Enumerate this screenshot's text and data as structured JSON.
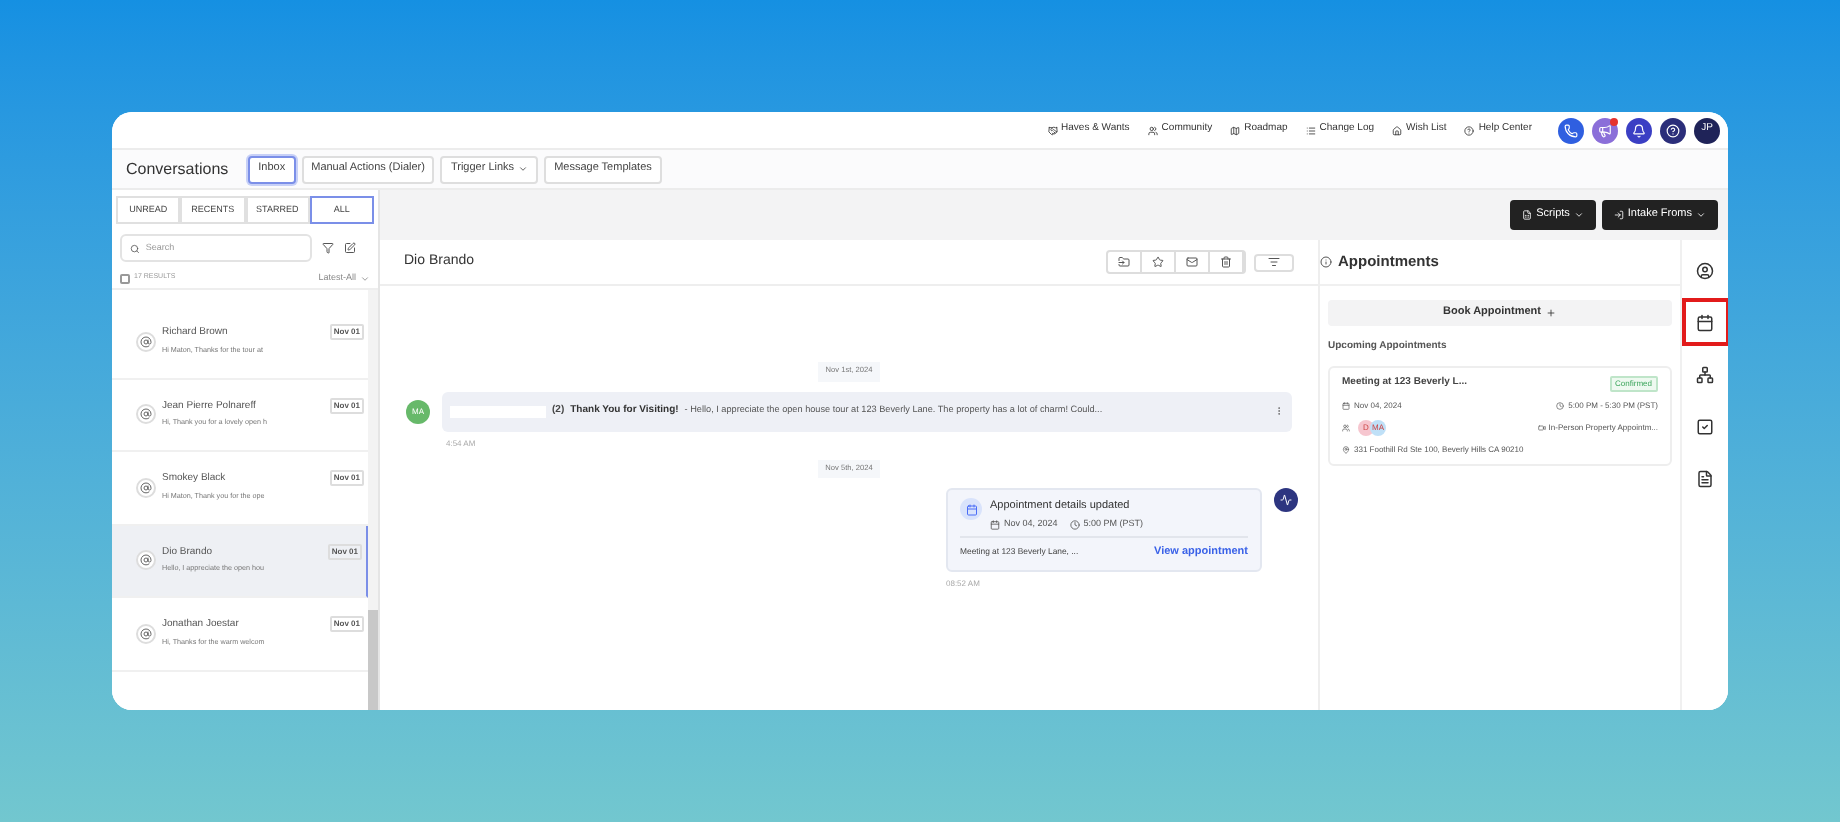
{
  "top_links": [
    {
      "kind": "haves",
      "label": "Haves & Wants"
    },
    {
      "kind": "community",
      "label": "Community"
    },
    {
      "kind": "roadmap",
      "label": "Roadmap"
    },
    {
      "kind": "changelog",
      "label": "Change Log"
    },
    {
      "kind": "wishlist",
      "label": "Wish List"
    },
    {
      "kind": "help",
      "label": "Help Center"
    }
  ],
  "top_actions": [
    {
      "kind": "phone",
      "color": "#2f5fe0",
      "badge": false
    },
    {
      "kind": "megaphone",
      "color": "#8b6fd9",
      "badge": true
    },
    {
      "kind": "bell",
      "color": "#3b3fc4",
      "badge": false
    },
    {
      "kind": "question",
      "color": "#2b2e7a",
      "badge": false
    }
  ],
  "user_avatar": {
    "initials": "JP"
  },
  "header": {
    "title": "Conversations",
    "tabs": [
      {
        "label": "Inbox",
        "selected": true,
        "dropdown": false
      },
      {
        "label": "Manual Actions (Dialer)",
        "selected": false,
        "dropdown": false
      },
      {
        "label": "Trigger Links",
        "selected": false,
        "dropdown": true
      },
      {
        "label": "Message Templates",
        "selected": false,
        "dropdown": false
      }
    ]
  },
  "filter_tabs": [
    {
      "label": "UNREAD",
      "selected": false
    },
    {
      "label": "RECENTS",
      "selected": false
    },
    {
      "label": "STARRED",
      "selected": false
    },
    {
      "label": "ALL",
      "selected": true
    }
  ],
  "search": {
    "placeholder": "Search"
  },
  "results": {
    "count": "17 RESULTS",
    "sort": "Latest-All",
    "checked": false
  },
  "conversations": [
    {
      "name": "Richard Brown",
      "preview": "Hi Maton,  Thanks for the tour at",
      "date": "Nov 01",
      "selected": false
    },
    {
      "name": "Jean Pierre Polnareff",
      "preview": "Hi,  Thank you for a lovely open h",
      "date": "Nov 01",
      "selected": false
    },
    {
      "name": "Smokey Black",
      "preview": "Hi Maton,  Thank you for the ope",
      "date": "Nov 01",
      "selected": false
    },
    {
      "name": "Dio Brando",
      "preview": "Hello,  I appreciate the open hou",
      "date": "Nov 01",
      "selected": true
    },
    {
      "name": "Jonathan Joestar",
      "preview": "Hi,  Thanks for the warm welcom",
      "date": "Nov 01",
      "selected": false
    }
  ],
  "toolbar_buttons": [
    {
      "kind": "scripts",
      "label": "Scripts"
    },
    {
      "kind": "intake",
      "label": "Intake Froms"
    }
  ],
  "thread": {
    "contact": "Dio Brando",
    "messages": [
      {
        "kind": "date",
        "label": "Nov 1st, 2024"
      },
      {
        "kind": "email",
        "avatar": "MA",
        "count": "(2)",
        "subject": "Thank You for Visiting!",
        "body": " -  Hello,  I appreciate the open house tour at 123 Beverly Lane. The property has a lot of charm!  Could...",
        "time": "4:54 AM"
      },
      {
        "kind": "date",
        "label": "Nov 5th, 2024"
      },
      {
        "kind": "appointment",
        "title": "Appointment details updated",
        "date": "Nov 04, 2024",
        "time_range": "5:00 PM (PST)",
        "summary": "Meeting at 123 Beverly Lane, ...",
        "link": "View appointment",
        "time": "08:52 AM"
      }
    ]
  },
  "appointments": {
    "title": "Appointments",
    "book_label": "Book Appointment",
    "section": "Upcoming Appointments",
    "items": [
      {
        "title": "Meeting at 123 Beverly L...",
        "status": "Confirmed",
        "date": "Nov 04, 2024",
        "time": "5:00 PM - 5:30 PM (PST)",
        "attendees": [
          {
            "initials": "D",
            "color": "#f6c6cf"
          },
          {
            "initials": "MA",
            "color": "#bfe0f7"
          }
        ],
        "type": "In-Person Property Appointm...",
        "address": "331 Foothill Rd Ste 100, Beverly Hills CA 90210"
      }
    ]
  },
  "rail": [
    {
      "kind": "contact",
      "highlighted": false
    },
    {
      "kind": "calendar",
      "highlighted": true
    },
    {
      "kind": "network",
      "highlighted": false
    },
    {
      "kind": "task",
      "highlighted": false
    },
    {
      "kind": "document",
      "highlighted": false
    }
  ]
}
